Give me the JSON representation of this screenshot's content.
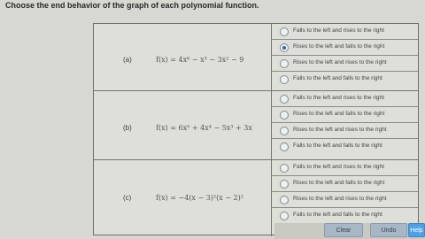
{
  "prompt": "Choose the end behavior of the graph of each polynomial function.",
  "questions": [
    {
      "label": "(a)",
      "function": "f(x) = 4x⁶ − x³ − 3x² − 9",
      "options": [
        "Falls to the left and rises to the right",
        "Rises to the left and falls to the right",
        "Rises to the left and rises to the right",
        "Falls to the left and falls to the right"
      ],
      "selected_index": 1
    },
    {
      "label": "(b)",
      "function": "f(x) = 6x⁵ + 4x⁴ − 5x³ + 3x",
      "options": [
        "Falls to the left and rises to the right",
        "Rises to the left and falls to the right",
        "Rises to the left and rises to the right",
        "Falls to the left and falls to the right"
      ],
      "selected_index": -1
    },
    {
      "label": "(c)",
      "function": "f(x) = −4(x − 3)²(x − 2)²",
      "options": [
        "Falls to the left and rises to the right",
        "Rises to the left and falls to the right",
        "Rises to the left and rises to the right",
        "Falls to the left and falls to the right"
      ],
      "selected_index": -1
    }
  ],
  "buttons": {
    "clear": "Clear",
    "undo": "Undo",
    "help": "Help"
  }
}
